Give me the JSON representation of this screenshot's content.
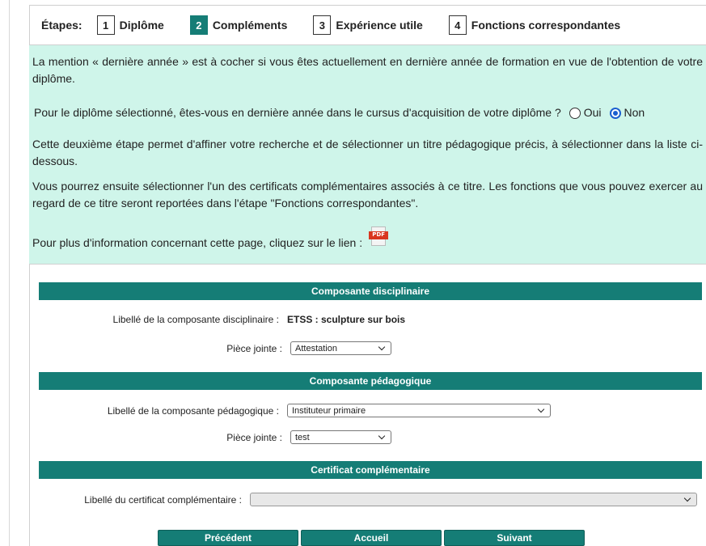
{
  "steps": {
    "label": "Étapes:",
    "items": [
      {
        "num": "1",
        "label": "Diplôme"
      },
      {
        "num": "2",
        "label": "Compléments",
        "active": true
      },
      {
        "num": "3",
        "label": "Expérience utile"
      },
      {
        "num": "4",
        "label": "Fonctions correspondantes"
      }
    ]
  },
  "intro": {
    "p1": "La mention « dernière année » est à cocher si vous êtes actuellement en dernière année de formation en vue de l'obtention de votre diplôme.",
    "question": "Pour le diplôme sélectionné, êtes-vous en dernière année dans le cursus d'acquisition de votre diplôme ?",
    "option_yes": "Oui",
    "option_no": "Non",
    "selected": "Non",
    "p2": "Cette deuxième étape permet d'affiner votre recherche et de sélectionner un titre pédagogique précis, à sélectionner dans la liste ci-dessous.",
    "p3": "Vous pourrez ensuite sélectionner l'un des certificats complémentaires associés à ce titre. Les fonctions que vous pouvez exercer au regard de ce titre seront reportées dans l'étape \"Fonctions correspondantes\".",
    "p4": "Pour plus d'information concernant cette page, cliquez sur le lien :",
    "pdf_icon": "pdf-icon",
    "pdf_text": "PDF"
  },
  "sections": {
    "disciplinaire": {
      "header": "Composante disciplinaire",
      "label": "Libellé de la composante disciplinaire",
      "value": "ETSS : sculpture sur bois",
      "piece_label": "Pièce jointe",
      "piece_value": "Attestation"
    },
    "pedagogique": {
      "header": "Composante pédagogique",
      "label": "Libellé de la composante pédagogique",
      "value": "Instituteur primaire",
      "piece_label": "Pièce jointe",
      "piece_value": "test"
    },
    "certificat": {
      "header": "Certificat complémentaire",
      "label": "Libellé du certificat complémentaire",
      "value": ""
    }
  },
  "buttons": {
    "previous": "Précédent",
    "home": "Accueil",
    "next": "Suivant"
  },
  "colors": {
    "accent": "#157d76",
    "intro_bg": "#cff5ea",
    "radio_selected": "#1a5fd0"
  }
}
